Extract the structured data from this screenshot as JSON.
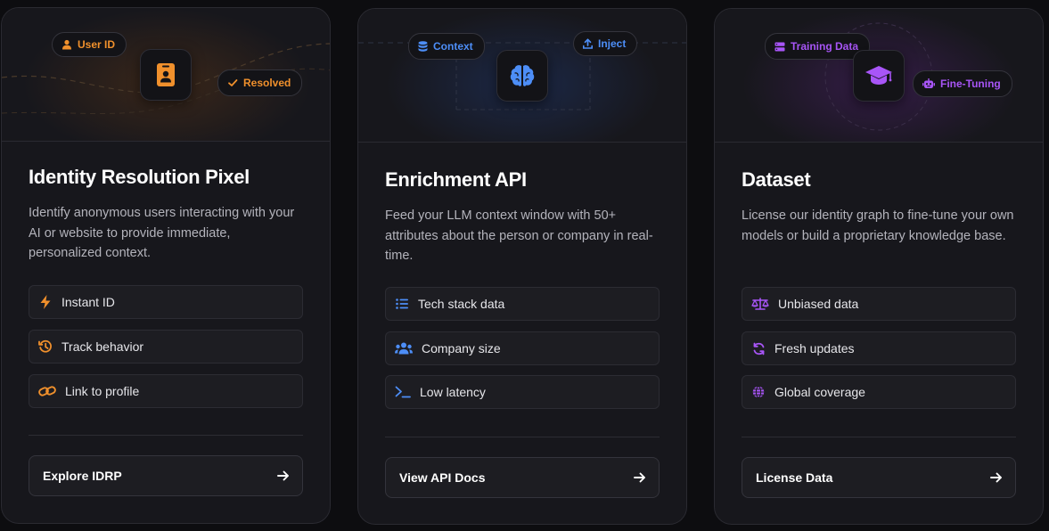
{
  "cards": [
    {
      "title": "Identity Resolution Pixel",
      "description": "Identify anonymous users interacting with your AI or website to provide immediate, personalized context.",
      "accent": "#f0902c",
      "pills": [
        {
          "label": "User ID",
          "icon": "user-icon"
        },
        {
          "label": "Resolved",
          "icon": "check-icon"
        }
      ],
      "center_icon": "id-badge-icon",
      "features": [
        {
          "label": "Instant ID",
          "icon": "lightning-icon"
        },
        {
          "label": "Track behavior",
          "icon": "history-icon"
        },
        {
          "label": "Link to profile",
          "icon": "link-icon"
        }
      ],
      "cta_label": "Explore IDRP"
    },
    {
      "title": "Enrichment API",
      "description": "Feed your LLM context window with 50+ attributes about the person or company in real-time.",
      "accent": "#4d8ef7",
      "pills": [
        {
          "label": "Context",
          "icon": "database-icon"
        },
        {
          "label": "Inject",
          "icon": "upload-icon"
        }
      ],
      "center_icon": "brain-icon",
      "features": [
        {
          "label": "Tech stack data",
          "icon": "list-icon"
        },
        {
          "label": "Company size",
          "icon": "users-icon"
        },
        {
          "label": "Low latency",
          "icon": "terminal-icon"
        }
      ],
      "cta_label": "View API Docs"
    },
    {
      "title": "Dataset",
      "description": "License our identity graph to fine-tune your own models or build a proprietary knowledge base.",
      "accent": "#a855f7",
      "pills": [
        {
          "label": "Training Data",
          "icon": "server-icon"
        },
        {
          "label": "Fine-Tuning",
          "icon": "robot-icon"
        }
      ],
      "center_icon": "graduation-cap-icon",
      "features": [
        {
          "label": "Unbiased data",
          "icon": "scale-icon"
        },
        {
          "label": "Fresh updates",
          "icon": "refresh-icon"
        },
        {
          "label": "Global coverage",
          "icon": "globe-icon"
        }
      ],
      "cta_label": "License Data"
    }
  ]
}
